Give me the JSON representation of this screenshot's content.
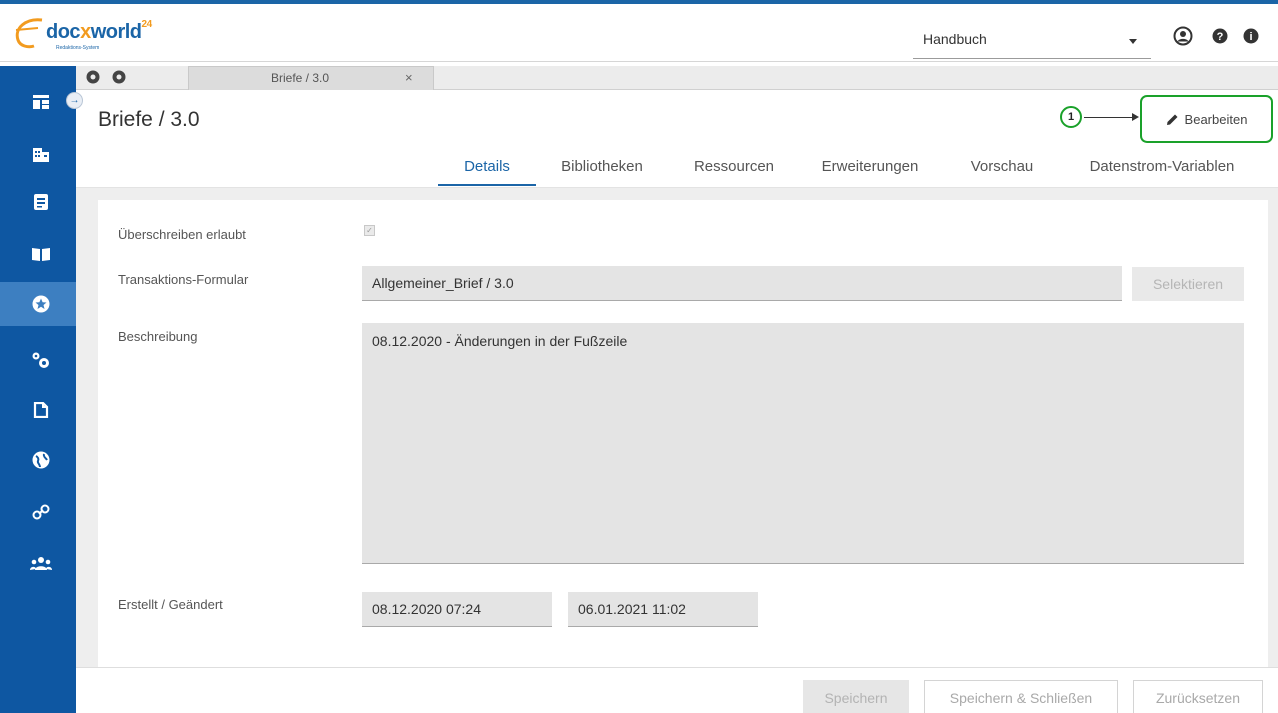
{
  "app": {
    "logo_text_a": "doc",
    "logo_text_x": "x",
    "logo_text_b": "world",
    "logo_sup": "24",
    "logo_sub": "Redaktions-System"
  },
  "topbar": {
    "handbook_value": "Handbuch",
    "icons": [
      "user-circle-icon",
      "help-icon",
      "info-icon"
    ]
  },
  "sidebar": {
    "items": [
      {
        "name": "dashboard-icon"
      },
      {
        "name": "building-icon"
      },
      {
        "name": "document-icon"
      },
      {
        "name": "book-icon"
      },
      {
        "name": "star-icon",
        "active": true
      },
      {
        "name": "cogs-icon"
      },
      {
        "name": "file-icon"
      },
      {
        "name": "globe-icon"
      },
      {
        "name": "link-icon"
      },
      {
        "name": "users-icon"
      }
    ],
    "toggle_glyph": "→"
  },
  "tabstrip": {
    "doc_tab_label": "Briefe / 3.0",
    "close_glyph": "×"
  },
  "header": {
    "title": "Briefe / 3.0",
    "edit_label": "Bearbeiten",
    "callout_number": "1"
  },
  "tabs": [
    {
      "label": "Details",
      "active": true
    },
    {
      "label": "Bibliotheken"
    },
    {
      "label": "Ressourcen"
    },
    {
      "label": "Erweiterungen"
    },
    {
      "label": "Vorschau"
    },
    {
      "label": "Datenstrom-Variablen"
    }
  ],
  "form": {
    "overwrite_label": "Überschreiben erlaubt",
    "overwrite_checked": true,
    "transaction_label": "Transaktions-Formular",
    "transaction_value": "Allgemeiner_Brief / 3.0",
    "select_label": "Selektieren",
    "description_label": "Beschreibung",
    "description_value": "08.12.2020 - Änderungen in der Fußzeile",
    "created_label": "Erstellt / Geändert",
    "created_value": "08.12.2020 07:24",
    "changed_value": "06.01.2021 11:02"
  },
  "footer": {
    "save_label": "Speichern",
    "save_close_label": "Speichern & Schließen",
    "reset_label": "Zurücksetzen"
  },
  "colors": {
    "brand_blue": "#0e57a2",
    "accent_orange": "#f29b1f",
    "highlight_green": "#1aa12a"
  }
}
